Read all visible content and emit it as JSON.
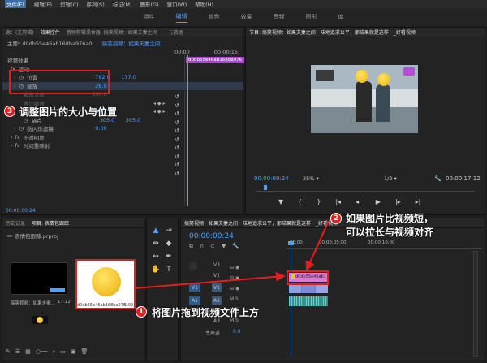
{
  "menu": [
    "文件(F)",
    "编辑(E)",
    "剪辑(C)",
    "序列(S)",
    "标记(M)",
    "图形(G)",
    "窗口(W)",
    "帮助(H)"
  ],
  "workspace_tabs": [
    "组件",
    "编辑",
    "颜色",
    "效果",
    "音频",
    "图形",
    "库"
  ],
  "effect_controls": {
    "tabs": [
      "源：(无剪辑)",
      "效果控件",
      "音频剪辑混合器: 搞笑视频：如果夫妻之间一",
      "元数据"
    ],
    "master_label": "主要* d0db55e46ab168ba976a0...",
    "sequence_label": "搞笑视频：如果夫妻之间...",
    "clip_name": "d0db55e46ab168ba976",
    "time_start": ":00:00",
    "time_end": "00:00:15",
    "section": "视频效果",
    "motion": "运动",
    "position_label": "位置",
    "position_x": "782.0",
    "position_y": "177.0",
    "scale_label": "缩放",
    "scale_value": "26.0",
    "scale_width": "缩放宽度",
    "scale_width_value": "100.0",
    "uniform_scale": "等比缩放",
    "rotation_label": "旋转",
    "rotation_value": "0.0",
    "anchor_label": "锚点",
    "anchor_x": "305.0",
    "anchor_y": "305.0",
    "flicker_label": "防闪烁滤镜",
    "flicker_value": "0.00",
    "opacity_label": "不透明度",
    "time_remap_label": "时间重映射",
    "timecode": "00:00:00:24"
  },
  "program": {
    "title": "节目: 搞笑视频：如果夫妻之间一味地追求公平，那结果就是这样！_好看视频",
    "timecode": "00:00:00:24",
    "zoom": "25%",
    "ratio": "1/2",
    "duration": "00:00:17:12"
  },
  "project": {
    "tabs": [
      "历史记录",
      "项目: 表情包跟踪"
    ],
    "file": "表情包跟踪.prproj",
    "item1_name": "搞笑视频：如果夫妻...",
    "item1_duration": "17:12",
    "item2_name": "d0db55e46ab168ba976...",
    "item2_duration": "5:00"
  },
  "timeline": {
    "title": "搞笑视频：如果夫妻之间一味地追求公平，那结果就是这样！_好看视频",
    "timecode": "00:00:00:24",
    "ruler": [
      ":00:00",
      "00:00:05:00",
      "00:00:10:00"
    ],
    "tracks_video": [
      "V3",
      "V2",
      "V1"
    ],
    "tracks_audio": [
      "A1",
      "A2",
      "A3"
    ],
    "master_label": "主声道",
    "master_value": "0.0",
    "clip_label": "d0db55e46ab1"
  },
  "annotations": {
    "a1_num": "1",
    "a1_text": "将图片拖到视频文件上方",
    "a2_num": "2",
    "a2_text_line1": "如果图片比视频短，",
    "a2_text_line2": "可以拉长与视频对齐",
    "a3_num": "3",
    "a3_text": "调整图片的大小与位置"
  },
  "colors": {
    "accent": "#4aa3ff",
    "annotation": "#e51d1d",
    "clip_pink": "#d97bd0"
  }
}
